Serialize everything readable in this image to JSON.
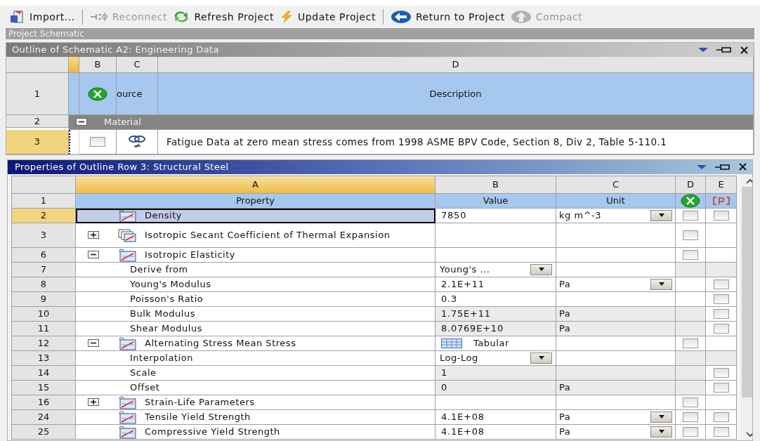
{
  "toolbar": [
    {
      "label": "Import...",
      "kind": "import",
      "disabled": false,
      "separator_after": true
    },
    {
      "label": "Reconnect",
      "kind": "reconnect",
      "disabled": true,
      "separator_after": false
    },
    {
      "label": "Refresh Project",
      "kind": "refresh",
      "disabled": false,
      "separator_after": false
    },
    {
      "label": "Update Project",
      "kind": "update",
      "disabled": false,
      "separator_after": true
    },
    {
      "label": "Return to Project",
      "kind": "return",
      "disabled": false,
      "separator_after": false
    },
    {
      "label": "Compact",
      "kind": "compact",
      "disabled": true,
      "separator_after": false
    }
  ],
  "project_bar": {
    "title": "Project Schematic"
  },
  "outline": {
    "title": "Outline of Schematic A2: Engineering Data",
    "columns": [
      "B",
      "C",
      "D"
    ],
    "header_row": {
      "number": "1",
      "source": "ource",
      "description": "Description"
    },
    "rows": [
      {
        "kind": "group",
        "number": "2",
        "label": "Material",
        "expanded": true
      },
      {
        "kind": "item",
        "number": "3",
        "selected": true,
        "checked": false,
        "description": "Fatigue Data at zero mean stress comes from 1998 ASME BPV Code, Section 8, Div 2, Table 5-110.1"
      }
    ]
  },
  "properties": {
    "title": "Properties of Outline Row 3: Structural Steel",
    "columns": [
      "A",
      "B",
      "C",
      "D",
      "E"
    ],
    "header_row": {
      "number": "1",
      "property": "Property",
      "value": "Value",
      "unit": "Unit"
    },
    "rows": [
      {
        "number": "2",
        "kind": "chart",
        "property": "Density",
        "value": {
          "kind": "text",
          "text": "7850"
        },
        "unit": {
          "kind": "dropdown",
          "text": "kg m^-3"
        },
        "selected": true,
        "d": {
          "checked": false
        },
        "e": {
          "checked": false
        }
      },
      {
        "number": "3",
        "kind": "stack",
        "expanded": false,
        "property": "Isotropic Secant Coefficient of Thermal Expansion",
        "selected": false,
        "d": {
          "checked": false
        }
      },
      {
        "number": "6",
        "kind": "chart",
        "expanded": true,
        "property": "Isotropic Elasticity",
        "selected": false,
        "d": {
          "checked": false
        }
      },
      {
        "number": "7",
        "kind": "child",
        "property": "Derive from",
        "value": {
          "kind": "dropdown",
          "text": "Young's ..."
        },
        "selected": false,
        "locked": true
      },
      {
        "number": "8",
        "kind": "child",
        "property": "Young's Modulus",
        "value": {
          "kind": "text",
          "text": "2.1E+11"
        },
        "unit": {
          "kind": "dropdown",
          "text": "Pa"
        },
        "selected": false,
        "e": {
          "checked": false
        }
      },
      {
        "number": "9",
        "kind": "child",
        "property": "Poisson's Ratio",
        "value": {
          "kind": "text",
          "text": "0.3"
        },
        "selected": false,
        "e": {
          "checked": false
        }
      },
      {
        "number": "10",
        "kind": "child",
        "property": "Bulk Modulus",
        "value": {
          "kind": "text",
          "text": "1.75E+11"
        },
        "unit": {
          "kind": "text",
          "text": "Pa"
        },
        "selected": false,
        "shaded": true,
        "e": {
          "checked": false
        }
      },
      {
        "number": "11",
        "kind": "child",
        "property": "Shear Modulus",
        "value": {
          "kind": "text",
          "text": "8.0769E+10"
        },
        "unit": {
          "kind": "text",
          "text": "Pa"
        },
        "selected": false,
        "shaded": true,
        "e": {
          "checked": false
        }
      },
      {
        "number": "12",
        "kind": "chart",
        "expanded": true,
        "property": "Alternating Stress Mean Stress",
        "value": {
          "kind": "tabular",
          "text": "Tabular"
        },
        "selected": false,
        "d": {
          "checked": false
        }
      },
      {
        "number": "13",
        "kind": "child",
        "property": "Interpolation",
        "value": {
          "kind": "dropdown",
          "text": "Log-Log"
        },
        "selected": false,
        "locked": true
      },
      {
        "number": "14",
        "kind": "child",
        "property": "Scale",
        "value": {
          "kind": "text",
          "text": "1"
        },
        "selected": false,
        "shaded": true,
        "e": {
          "checked": false
        }
      },
      {
        "number": "15",
        "kind": "child",
        "property": "Offset",
        "value": {
          "kind": "text",
          "text": "0"
        },
        "unit": {
          "kind": "text",
          "text": "Pa"
        },
        "selected": false,
        "shaded": true,
        "e": {
          "checked": false
        }
      },
      {
        "number": "16",
        "kind": "chart",
        "expanded": false,
        "property": "Strain-Life Parameters",
        "selected": false,
        "d": {
          "checked": false
        }
      },
      {
        "number": "24",
        "kind": "chart",
        "property": "Tensile Yield Strength",
        "value": {
          "kind": "text",
          "text": "4.1E+08"
        },
        "unit": {
          "kind": "dropdown",
          "text": "Pa"
        },
        "selected": false,
        "d": {
          "checked": false
        },
        "e": {
          "checked": false
        }
      },
      {
        "number": "25",
        "kind": "chart",
        "property": "Compressive Yield Strength",
        "value": {
          "kind": "text",
          "text": "4.1E+08"
        },
        "unit": {
          "kind": "dropdown",
          "text": "Pa"
        },
        "selected": false,
        "d": {
          "checked": false
        },
        "e": {
          "checked": false
        }
      }
    ]
  }
}
